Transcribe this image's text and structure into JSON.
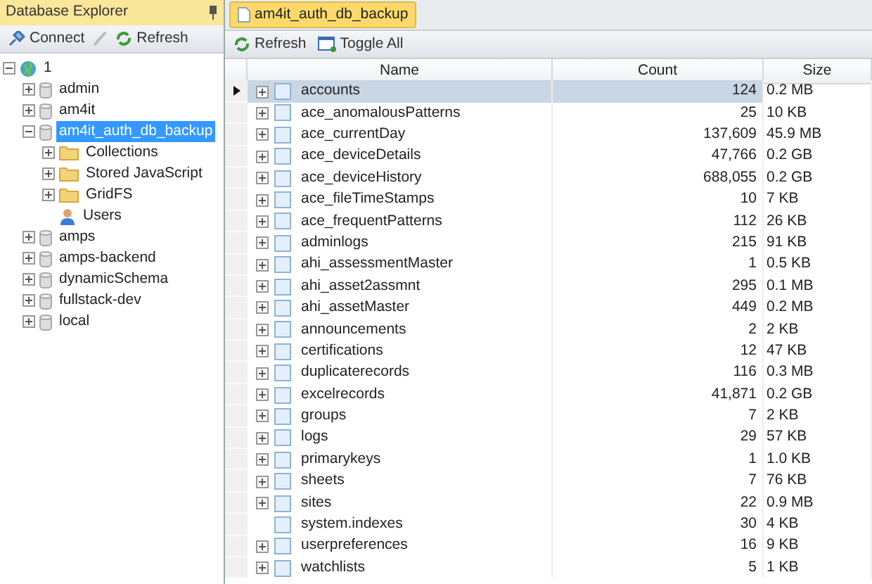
{
  "explorer": {
    "title": "Database Explorer",
    "toolbar": [
      "Connect",
      "Refresh"
    ],
    "tree": [
      {
        "label": "1",
        "kind": "server",
        "expanded": true,
        "selected": false,
        "children": [
          {
            "label": "admin",
            "kind": "database",
            "expanded": false,
            "selected": false
          },
          {
            "label": "am4it",
            "kind": "database",
            "expanded": false,
            "selected": false
          },
          {
            "label": "am4it_auth_db_backup",
            "kind": "database",
            "expanded": true,
            "selected": true,
            "children": [
              {
                "label": "Collections",
                "kind": "folder",
                "expanded": false,
                "selected": false
              },
              {
                "label": "Stored JavaScript",
                "kind": "folder",
                "expanded": false,
                "selected": false
              },
              {
                "label": "GridFS",
                "kind": "folder",
                "expanded": false,
                "selected": false
              },
              {
                "label": "Users",
                "kind": "users",
                "selected": false
              }
            ]
          },
          {
            "label": "amps",
            "kind": "database",
            "expanded": false,
            "selected": false
          },
          {
            "label": "amps-backend",
            "kind": "database",
            "expanded": false,
            "selected": false
          },
          {
            "label": "dynamicSchema",
            "kind": "database",
            "expanded": false,
            "selected": false
          },
          {
            "label": "fullstack-dev",
            "kind": "database",
            "expanded": false,
            "selected": false
          },
          {
            "label": "local",
            "kind": "database",
            "expanded": false,
            "selected": false
          }
        ]
      }
    ]
  },
  "document_tab": {
    "label": "am4it_auth_db_backup",
    "selected": true
  },
  "toolbar": [
    "Refresh",
    "Toggle All"
  ],
  "table": {
    "columns": [
      "Name",
      "Count",
      "Size"
    ],
    "rows": [
      {
        "name": "accounts",
        "count": "124",
        "size": "0.2 MB",
        "selected": true,
        "expandable": true
      },
      {
        "name": "ace_anomalousPatterns",
        "count": "25",
        "size": "10 KB",
        "selected": false,
        "expandable": true
      },
      {
        "name": "ace_currentDay",
        "count": "137,609",
        "size": "45.9 MB",
        "selected": false,
        "expandable": true
      },
      {
        "name": "ace_deviceDetails",
        "count": "47,766",
        "size": "0.2 GB",
        "selected": false,
        "expandable": true
      },
      {
        "name": "ace_deviceHistory",
        "count": "688,055",
        "size": "0.2 GB",
        "selected": false,
        "expandable": true
      },
      {
        "name": "ace_fileTimeStamps",
        "count": "10",
        "size": "7 KB",
        "selected": false,
        "expandable": true
      },
      {
        "name": "ace_frequentPatterns",
        "count": "112",
        "size": "26 KB",
        "selected": false,
        "expandable": true
      },
      {
        "name": "adminlogs",
        "count": "215",
        "size": "91 KB",
        "selected": false,
        "expandable": true
      },
      {
        "name": "ahi_assessmentMaster",
        "count": "1",
        "size": "0.5 KB",
        "selected": false,
        "expandable": true
      },
      {
        "name": "ahi_asset2assmnt",
        "count": "295",
        "size": "0.1 MB",
        "selected": false,
        "expandable": true
      },
      {
        "name": "ahi_assetMaster",
        "count": "449",
        "size": "0.2 MB",
        "selected": false,
        "expandable": true
      },
      {
        "name": "announcements",
        "count": "2",
        "size": "2 KB",
        "selected": false,
        "expandable": true
      },
      {
        "name": "certifications",
        "count": "12",
        "size": "47 KB",
        "selected": false,
        "expandable": true
      },
      {
        "name": "duplicaterecords",
        "count": "116",
        "size": "0.3 MB",
        "selected": false,
        "expandable": true
      },
      {
        "name": "excelrecords",
        "count": "41,871",
        "size": "0.2 GB",
        "selected": false,
        "expandable": true
      },
      {
        "name": "groups",
        "count": "7",
        "size": "2 KB",
        "selected": false,
        "expandable": true
      },
      {
        "name": "logs",
        "count": "29",
        "size": "57 KB",
        "selected": false,
        "expandable": true
      },
      {
        "name": "primarykeys",
        "count": "1",
        "size": "1.0 KB",
        "selected": false,
        "expandable": true
      },
      {
        "name": "sheets",
        "count": "7",
        "size": "76 KB",
        "selected": false,
        "expandable": true
      },
      {
        "name": "sites",
        "count": "22",
        "size": "0.9 MB",
        "selected": false,
        "expandable": true
      },
      {
        "name": "system.indexes",
        "count": "30",
        "size": "4 KB",
        "selected": false,
        "expandable": false
      },
      {
        "name": "userpreferences",
        "count": "16",
        "size": "9 KB",
        "selected": false,
        "expandable": true
      },
      {
        "name": "watchlists",
        "count": "5",
        "size": "1 KB",
        "selected": false,
        "expandable": true
      }
    ]
  }
}
